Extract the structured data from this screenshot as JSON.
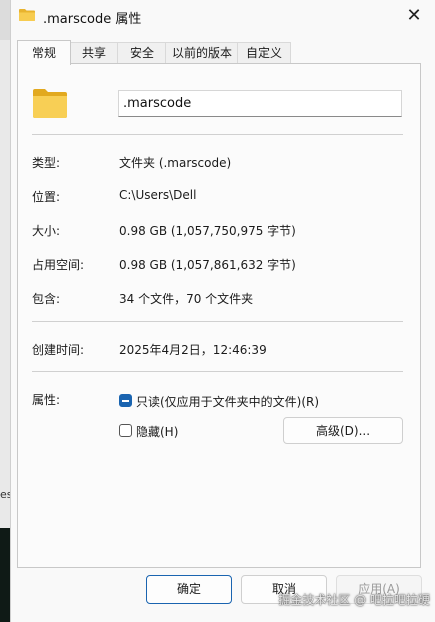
{
  "window": {
    "title": ".marscode 属性",
    "close_glyph": "✕"
  },
  "tabs": [
    "常规",
    "共享",
    "安全",
    "以前的版本",
    "自定义"
  ],
  "general": {
    "name": ".marscode",
    "rows": [
      {
        "label": "类型:",
        "value": "文件夹 (.marscode)"
      },
      {
        "label": "位置:",
        "value": "C:\\Users\\Dell"
      },
      {
        "label": "大小:",
        "value": "0.98 GB (1,057,750,975 字节)"
      },
      {
        "label": "占用空间:",
        "value": "0.98 GB (1,057,861,632 字节)"
      },
      {
        "label": "包含:",
        "value": "34 个文件，70 个文件夹"
      }
    ],
    "created_label": "创建时间:",
    "created_value": "2025年4月2日，12:46:39",
    "attributes_label": "属性:",
    "readonly_label": "只读(仅应用于文件夹中的文件)(R)",
    "readonly_state": "indeterminate",
    "hidden_label": "隐藏(H)",
    "hidden_state": "unchecked",
    "advanced_button": "高级(D)..."
  },
  "buttons": {
    "ok": "确定",
    "cancel": "取消",
    "apply": "应用(A)"
  },
  "background": {
    "edge_text": "es"
  },
  "watermark": "掘金技术社区 @ 吧拉吧拉硬",
  "colors": {
    "accent": "#1a64b0",
    "folder": "#f4c542"
  },
  "icons": {
    "title": "folder-icon",
    "main": "folder-icon",
    "close": "close-icon"
  }
}
